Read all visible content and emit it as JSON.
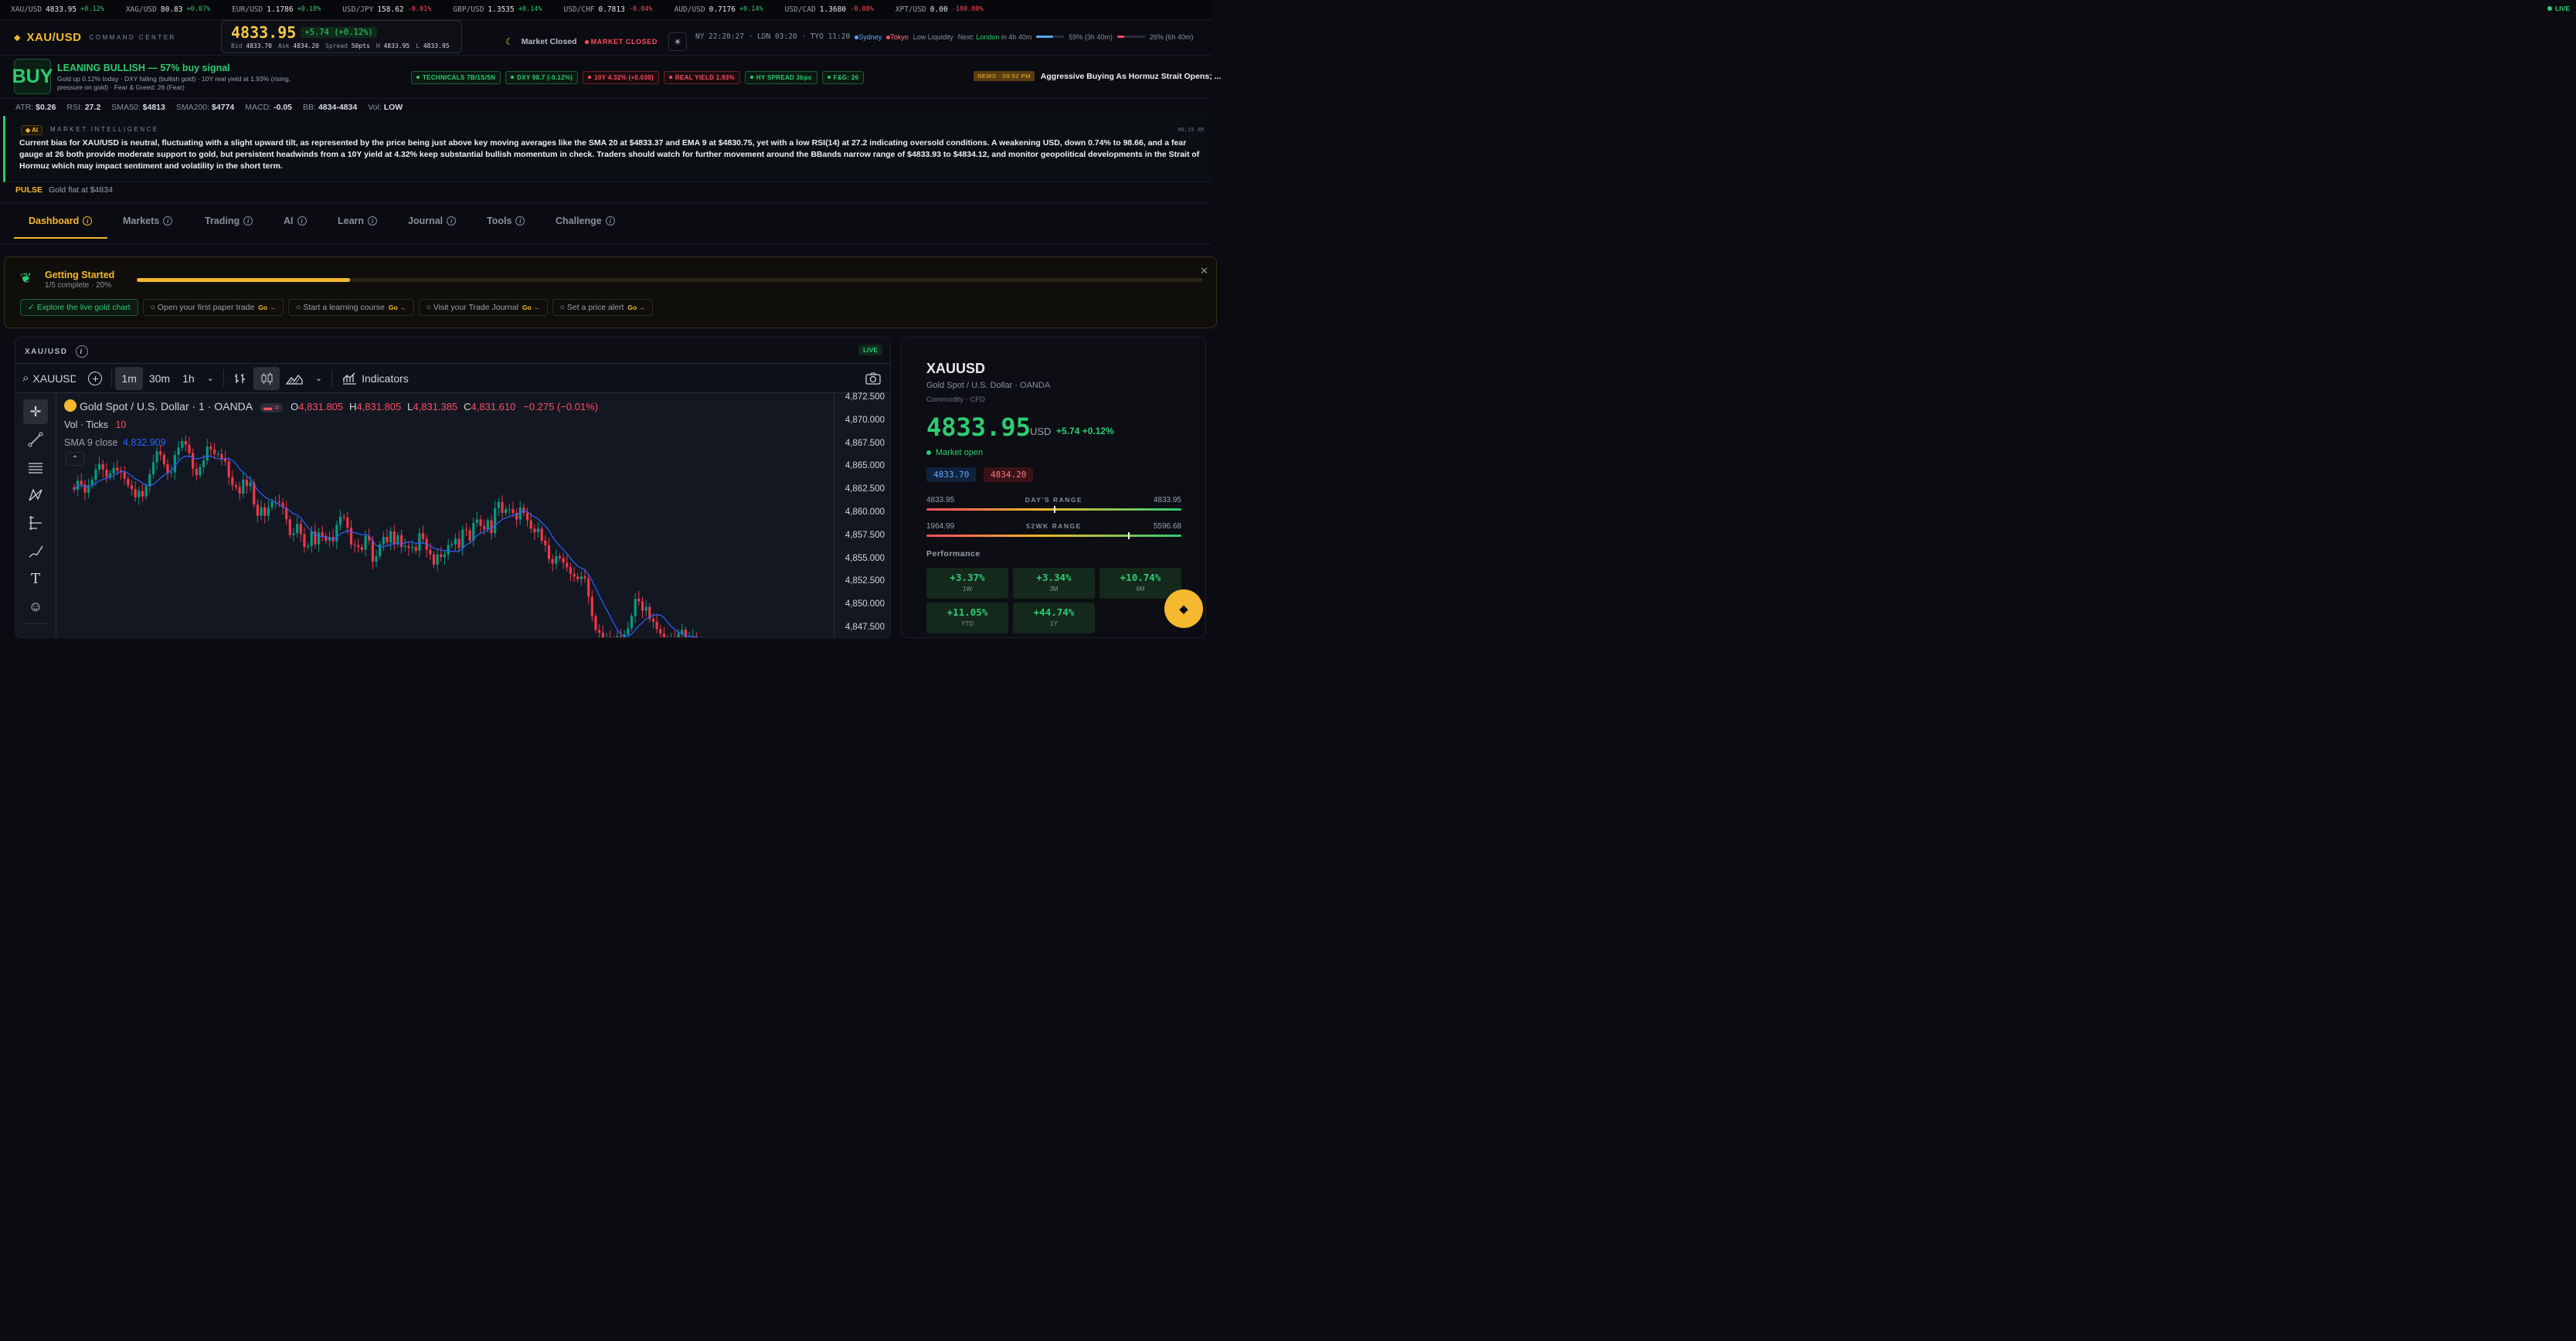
{
  "ticker": [
    {
      "sym": "XAU/USD",
      "price": "4833.95",
      "chg": "+0.12%",
      "dir": "up"
    },
    {
      "sym": "XAG/USD",
      "price": "80.83",
      "chg": "+0.07%",
      "dir": "up"
    },
    {
      "sym": "EUR/USD",
      "price": "1.1786",
      "chg": "+0.18%",
      "dir": "up"
    },
    {
      "sym": "USD/JPY",
      "price": "158.62",
      "chg": "-0.01%",
      "dir": "dn"
    },
    {
      "sym": "GBP/USD",
      "price": "1.3535",
      "chg": "+0.14%",
      "dir": "up"
    },
    {
      "sym": "USD/CHF",
      "price": "0.7813",
      "chg": "-0.04%",
      "dir": "dn"
    },
    {
      "sym": "AUD/USD",
      "price": "0.7176",
      "chg": "+0.14%",
      "dir": "up"
    },
    {
      "sym": "USD/CAD",
      "price": "1.3680",
      "chg": "-0.08%",
      "dir": "dn"
    },
    {
      "sym": "XPT/USD",
      "price": "0.00",
      "chg": "-100.00%",
      "dir": "dn"
    }
  ],
  "live_label": "LIVE",
  "header": {
    "symbol": "XAU/USD",
    "subtitle": "COMMAND CENTER",
    "price": "4833.95",
    "change": "+5.74 (+0.12%)",
    "bid_label": "Bid",
    "bid": "4833.70",
    "ask_label": "Ask",
    "ask": "4834.20",
    "spread_label": "Spread",
    "spread": "50pts",
    "high_label": "H",
    "high": "4833.95",
    "low_label": "L",
    "low": "4833.95",
    "market_status": "Market Closed",
    "market_badge": "MARKET CLOSED",
    "clocks": "NY 22:20:27 · LDN 03:20 · TYO 11:20",
    "sess1": "Sydney",
    "sess2": "Tokyo",
    "liquidity": "Low Liquidity",
    "next_label": "Next:",
    "next_city": "London",
    "next_when": "in 4h 40m",
    "prog1_label": "59% (3h 40m)",
    "prog1": 0.59,
    "prog2_label": "26% (6h 40m)",
    "prog2": 0.26
  },
  "signal": {
    "badge": "BUY",
    "headline": "LEANING BULLISH — 57% buy signal",
    "detail": "Gold up 0.12% today · DXY falling (bullish gold) · 10Y real yield at 1.93% (rising, pressure on gold) · Fear & Greed: 26 (Fear)",
    "chips": [
      {
        "t": "TECHNICALS 7B/1S/5N",
        "c": "g"
      },
      {
        "t": "DXY 98.7 (-0.12%)",
        "c": "g"
      },
      {
        "t": "10Y 4.32% (+0.030)",
        "c": "r"
      },
      {
        "t": "REAL YIELD 1.93%",
        "c": "r"
      },
      {
        "t": "HY SPREAD 3bps",
        "c": "g"
      },
      {
        "t": "F&G: 26",
        "c": "g"
      }
    ],
    "news_tag": "NEWS · 09:52 PM",
    "news": "Aggressive Buying As Hormuz Strait Opens; ..."
  },
  "stats": [
    {
      "k": "ATR:",
      "v": "$0.26",
      "c": ""
    },
    {
      "k": "RSI:",
      "v": "27.2",
      "c": "up"
    },
    {
      "k": "SMA50:",
      "v": "$4813",
      "c": ""
    },
    {
      "k": "SMA200:",
      "v": "$4774",
      "c": ""
    },
    {
      "k": "MACD:",
      "v": "-0.05",
      "c": "dn"
    },
    {
      "k": "BB:",
      "v": "4834-4834",
      "c": ""
    },
    {
      "k": "Vol:",
      "v": "LOW",
      "c": "up"
    }
  ],
  "ai": {
    "tag": "AI",
    "title": "MARKET INTELLIGENCE",
    "time": "06:19 AM",
    "text": "Current bias for XAU/USD is neutral, fluctuating with a slight upward tilt, as represented by the price being just above key moving averages like the SMA 20 at $4833.37 and EMA 9 at $4830.75, yet with a low RSI(14) at 27.2 indicating oversold conditions. A weakening USD, down 0.74% to 98.66, and a fear gauge at 26 both provide moderate support to gold, but persistent headwinds from a 10Y yield at 4.32% keep substantial bullish momentum in check. Traders should watch for further movement around the BBands narrow range of $4833.93 to $4834.12, and monitor geopolitical developments in the Strait of Hormuz which may impact sentiment and volatility in the short term."
  },
  "pulse": {
    "label": "PULSE",
    "text": "Gold flat at $4834"
  },
  "tabs": [
    "Dashboard",
    "Markets",
    "Trading",
    "AI",
    "Learn",
    "Journal",
    "Tools",
    "Challenge"
  ],
  "getting_started": {
    "title": "Getting Started",
    "sub": "1/5 complete · 20%",
    "progress": 0.2,
    "steps": [
      {
        "t": "✓ Explore the live gold chart",
        "done": true
      },
      {
        "t": "○ Open your first paper trade",
        "done": false
      },
      {
        "t": "○ Start a learning course",
        "done": false
      },
      {
        "t": "○ Visit your Trade Journal",
        "done": false
      },
      {
        "t": "○ Set a price alert",
        "done": false
      }
    ],
    "go": "Go →"
  },
  "chart_panel": {
    "title": "XAU/USD",
    "live": "LIVE",
    "search": "XAUUSD",
    "intervals": [
      "1m",
      "30m",
      "1h"
    ],
    "indicators": "Indicators",
    "legend_title": "Gold Spot / U.S. Dollar · 1 · OANDA",
    "ohlc": {
      "O": "4,831.805",
      "H": "4,831.805",
      "L": "4,831.385",
      "C": "4,831.610",
      "chg": "−0.275 (−0.01%)"
    },
    "vol_label": "Vol · Ticks",
    "vol_value": "10",
    "sma_label": "SMA 9 close",
    "sma_value": "4,832.909"
  },
  "chart_data": {
    "type": "candlestick",
    "ylim": [
      4846.0,
      4873.0
    ],
    "y_ticks": [
      "4,872.500",
      "4,870.000",
      "4,867.500",
      "4,865.000",
      "4,862.500",
      "4,860.000",
      "4,857.500",
      "4,855.000",
      "4,852.500",
      "4,850.000",
      "4,847.500"
    ],
    "close": [
      4862.5,
      4863.5,
      4863.1,
      4862.2,
      4863.0,
      4863.6,
      4864.7,
      4865.3,
      4864.7,
      4863.9,
      4864.3,
      4864.9,
      4864.6,
      4864.4,
      4863.7,
      4863.0,
      4862.6,
      4861.7,
      4862.4,
      4861.8,
      4862.9,
      4864.2,
      4865.5,
      4866.7,
      4866.3,
      4865.3,
      4864.3,
      4864.4,
      4866.3,
      4867.1,
      4867.8,
      4867.4,
      4866.5,
      4864.8,
      4864.1,
      4865.0,
      4865.7,
      4867.2,
      4866.9,
      4866.4,
      4866.4,
      4865.9,
      4865.6,
      4863.9,
      4863.0,
      4862.8,
      4862.1,
      4863.6,
      4862.9,
      4863.3,
      4860.9,
      4859.7,
      4860.6,
      4859.7,
      4860.6,
      4861.2,
      4861.2,
      4861.1,
      4860.6,
      4859.3,
      4857.6,
      4857.8,
      4858.8,
      4857.7,
      4856.3,
      4856.4,
      4858.0,
      4856.6,
      4857.9,
      4857.5,
      4857.0,
      4857.4,
      4856.9,
      4858.7,
      4859.6,
      4859.5,
      4858.4,
      4856.6,
      4856.5,
      4856.3,
      4856.0,
      4857.5,
      4857.0,
      4854.7,
      4855.3,
      4856.6,
      4857.4,
      4856.8,
      4858.0,
      4856.6,
      4857.6,
      4856.3,
      4856.4,
      4856.2,
      4856.3,
      4855.9,
      4857.8,
      4857.2,
      4856.0,
      4855.5,
      4854.4,
      4855.5,
      4855.2,
      4855.5,
      4856.5,
      4856.6,
      4857.2,
      4856.2,
      4858.2,
      4858.1,
      4857.0,
      4858.9,
      4859.3,
      4858.6,
      4858.2,
      4859.2,
      4857.8,
      4860.5,
      4861.2,
      4860.0,
      4860.4,
      4860.4,
      4860.0,
      4859.3,
      4860.6,
      4860.0,
      4859.2,
      4858.3,
      4857.9,
      4858.3,
      4857.0,
      4856.5,
      4855.0,
      4854.5,
      4855.3,
      4855.1,
      4854.6,
      4854.1,
      4853.4,
      4853.1,
      4852.8,
      4853.1,
      4852.9,
      4850.9,
      4848.8,
      4847.3,
      4847.0,
      4846.4,
      4846.5,
      4846.3,
      4846.2,
      4846.6,
      4846.5,
      4846.8,
      4847.5,
      4848.8,
      4850.7,
      4850.4,
      4849.4,
      4849.8,
      4848.5,
      4848.2,
      4847.4,
      4846.9,
      4846.4,
      4846.2,
      4846.4,
      4846.3,
      4846.9,
      4847.3,
      4846.5,
      4846.5,
      4846.6,
      4846.0
    ],
    "sma_label": "SMA 9 close"
  },
  "quote": {
    "symbol": "XAUUSD",
    "name": "Gold Spot / U.S. Dollar · OANDA",
    "type": "Commodity · CFD",
    "price": "4833.95",
    "ccy": "USD",
    "chg": "+5.74 +0.12%",
    "status": "Market open",
    "bid": "4833.70",
    "ask": "4834.20",
    "day_lo": "4833.95",
    "day_label": "DAY'S RANGE",
    "day_hi": "4833.95",
    "day_pos": 0.5,
    "wk_lo": "1964.99",
    "wk_label": "52WK RANGE",
    "wk_hi": "5596.68",
    "wk_pos": 0.79,
    "perf_title": "Performance",
    "perf": [
      {
        "v": "+3.37%",
        "l": "1W"
      },
      {
        "v": "+3.34%",
        "l": "3M"
      },
      {
        "v": "+10.74%",
        "l": "6M"
      },
      {
        "v": "+11.05%",
        "l": "YTD"
      },
      {
        "v": "+44.74%",
        "l": "1Y"
      }
    ]
  },
  "colors": {
    "accent": "#f5b82e",
    "up": "#2ecc71",
    "down": "#ff4d5e",
    "sma": "#2962ff"
  }
}
